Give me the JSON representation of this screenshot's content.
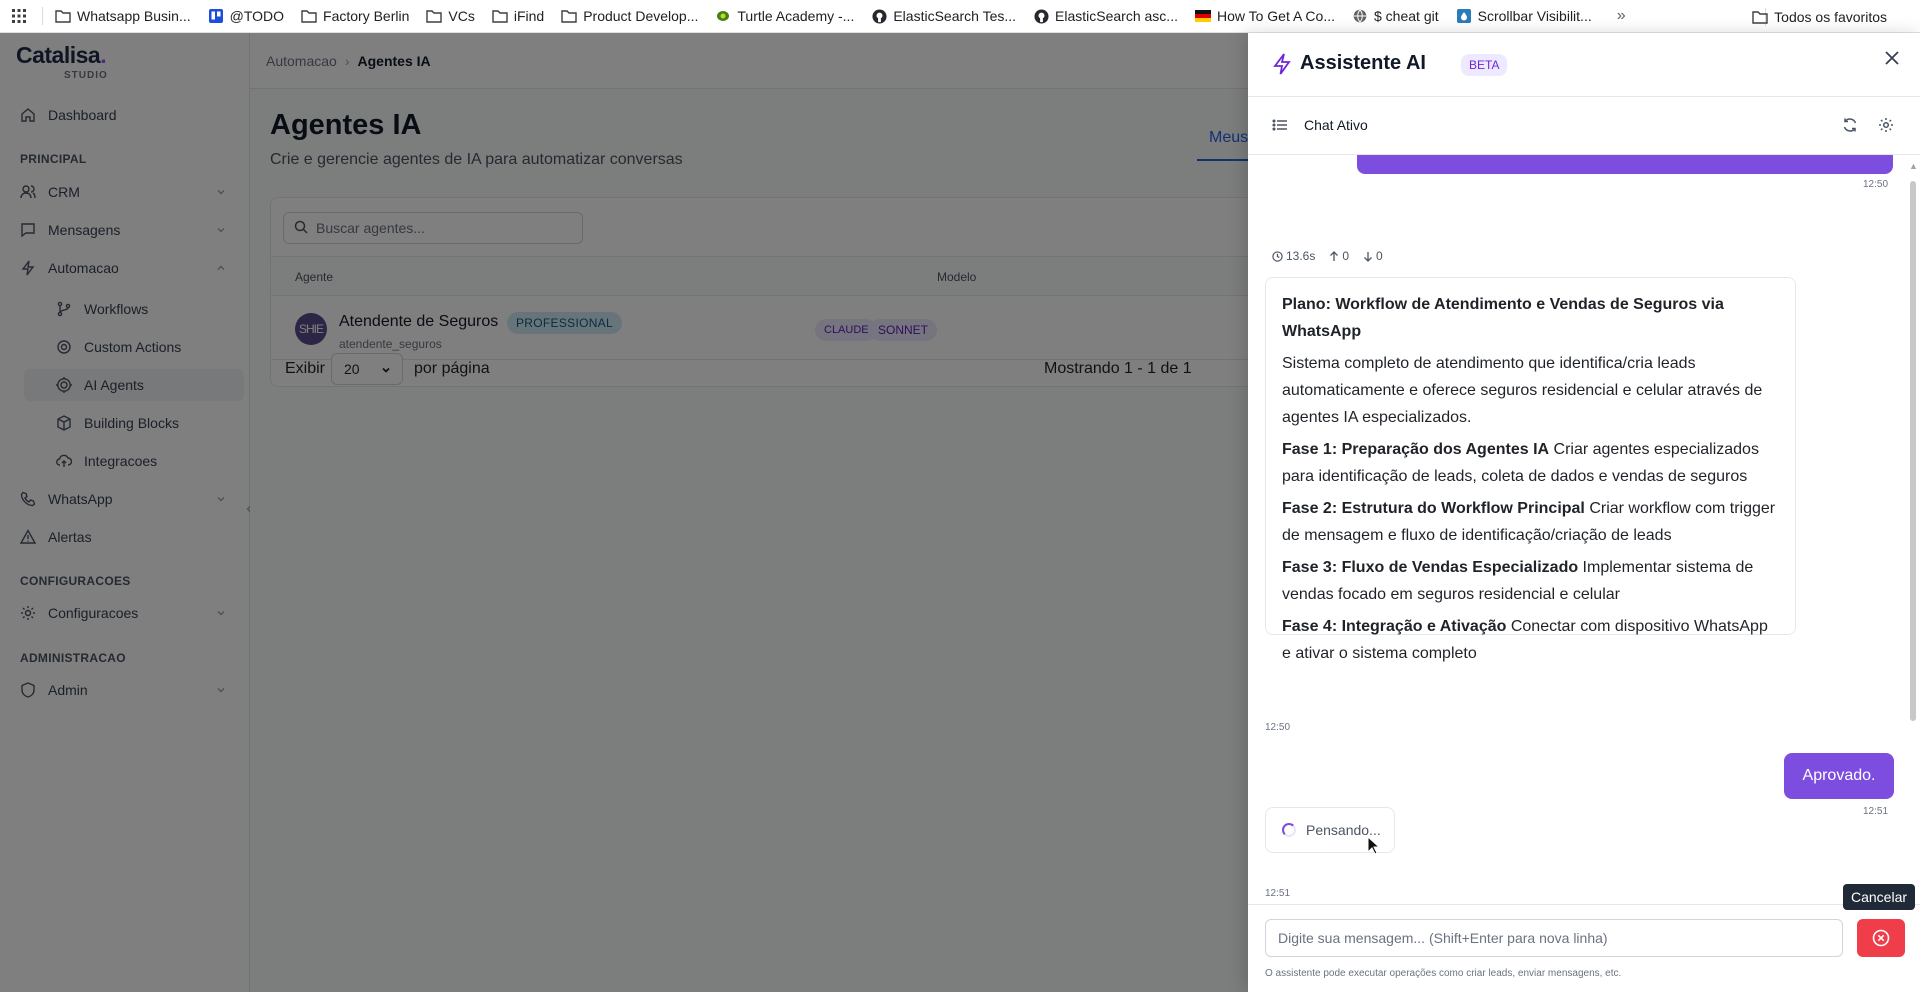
{
  "bookmarks": {
    "items": [
      {
        "label": "Whatsapp Busin...",
        "icon": "folder-icon"
      },
      {
        "label": "@TODO",
        "icon": "trello-icon"
      },
      {
        "label": "Factory Berlin",
        "icon": "folder-icon"
      },
      {
        "label": "VCs",
        "icon": "folder-icon"
      },
      {
        "label": "iFind",
        "icon": "folder-icon"
      },
      {
        "label": "Product Develop...",
        "icon": "folder-icon"
      },
      {
        "label": "Turtle Academy -...",
        "icon": "turtle-icon"
      },
      {
        "label": "ElasticSearch Tes...",
        "icon": "github-icon"
      },
      {
        "label": "ElasticSearch asc...",
        "icon": "github-icon"
      },
      {
        "label": "How To Get A Co...",
        "icon": "flag-icon"
      },
      {
        "label": "$ cheat git",
        "icon": "globe-icon"
      },
      {
        "label": "Scrollbar Visibilit...",
        "icon": "drop-icon"
      }
    ],
    "more": "»",
    "all_favorites": "Todos os favoritos"
  },
  "app": {
    "logo_main": "Catalisa",
    "logo_dot": ".",
    "logo_sub": "STUDIO"
  },
  "sidebar": {
    "dashboard": "Dashboard",
    "section_principal": "PRINCIPAL",
    "crm": "CRM",
    "mensagens": "Mensagens",
    "automacao": "Automacao",
    "workflows": "Workflows",
    "custom_actions": "Custom Actions",
    "ai_agents": "AI Agents",
    "building_blocks": "Building Blocks",
    "integracoes": "Integracoes",
    "whatsapp": "WhatsApp",
    "alertas": "Alertas",
    "section_config": "CONFIGURACOES",
    "configuracoes": "Configuracoes",
    "section_admin": "ADMINISTRACAO",
    "admin": "Admin"
  },
  "breadcrumb": {
    "parent": "Automacao",
    "separator": "›",
    "current": "Agentes IA"
  },
  "page": {
    "title": "Agentes IA",
    "subtitle": "Crie e gerencie agentes de IA para automatizar conversas",
    "tab_meus": "Meus A"
  },
  "table": {
    "search_placeholder": "Buscar agentes...",
    "col_agente": "Agente",
    "col_modelo": "Modelo",
    "row": {
      "avatar_text": "SHIE",
      "name": "Atendente de Seguros",
      "badge": "PROFESSIONAL",
      "slug": "atendente_seguros",
      "model_1": "CLAUDE",
      "model_2": "SONNET"
    },
    "pager_show": "Exibir",
    "pager_value": "20",
    "pager_per_page": "por página",
    "pager_showing": "Mostrando 1 - 1 de 1"
  },
  "assistant": {
    "title": "Assistente AI",
    "beta": "BETA",
    "chat_title": "Chat Ativo",
    "prev_user_ts": "12:50",
    "meta_time": "13.6s",
    "meta_up": "0",
    "meta_down": "0",
    "plan_title": "Plano: Workflow de Atendimento e Vendas de Seguros via WhatsApp",
    "plan_desc": "Sistema completo de atendimento que identifica/cria leads automaticamente e oferece seguros residencial e celular através de agentes IA especializados.",
    "phases": [
      {
        "title": "Fase 1: Preparação dos Agentes IA",
        "text": " Criar agentes especializados para identificação de leads, coleta de dados e vendas de seguros"
      },
      {
        "title": "Fase 2: Estrutura do Workflow Principal",
        "text": " Criar workflow com trigger de mensagem e fluxo de identificação/criação de leads"
      },
      {
        "title": "Fase 3: Fluxo de Vendas Especializado",
        "text": " Implementar sistema de vendas focado em seguros residencial e celular"
      },
      {
        "title": "Fase 4: Integração e Ativação",
        "text": " Conectar com dispositivo WhatsApp e ativar o sistema completo"
      }
    ],
    "plan_ts": "12:50",
    "user_msg": "Aprovado.",
    "user_ts": "12:51",
    "thinking": "Pensando...",
    "thinking_ts": "12:51",
    "cancel_tooltip": "Cancelar",
    "input_placeholder": "Digite sua mensagem... (Shift+Enter para nova linha)",
    "hint": "O assistente pode executar operações como criar leads, enviar mensagens, etc."
  },
  "colors": {
    "accent": "#7c4ddf",
    "danger": "#ef3e4a",
    "link": "#2563eb"
  }
}
